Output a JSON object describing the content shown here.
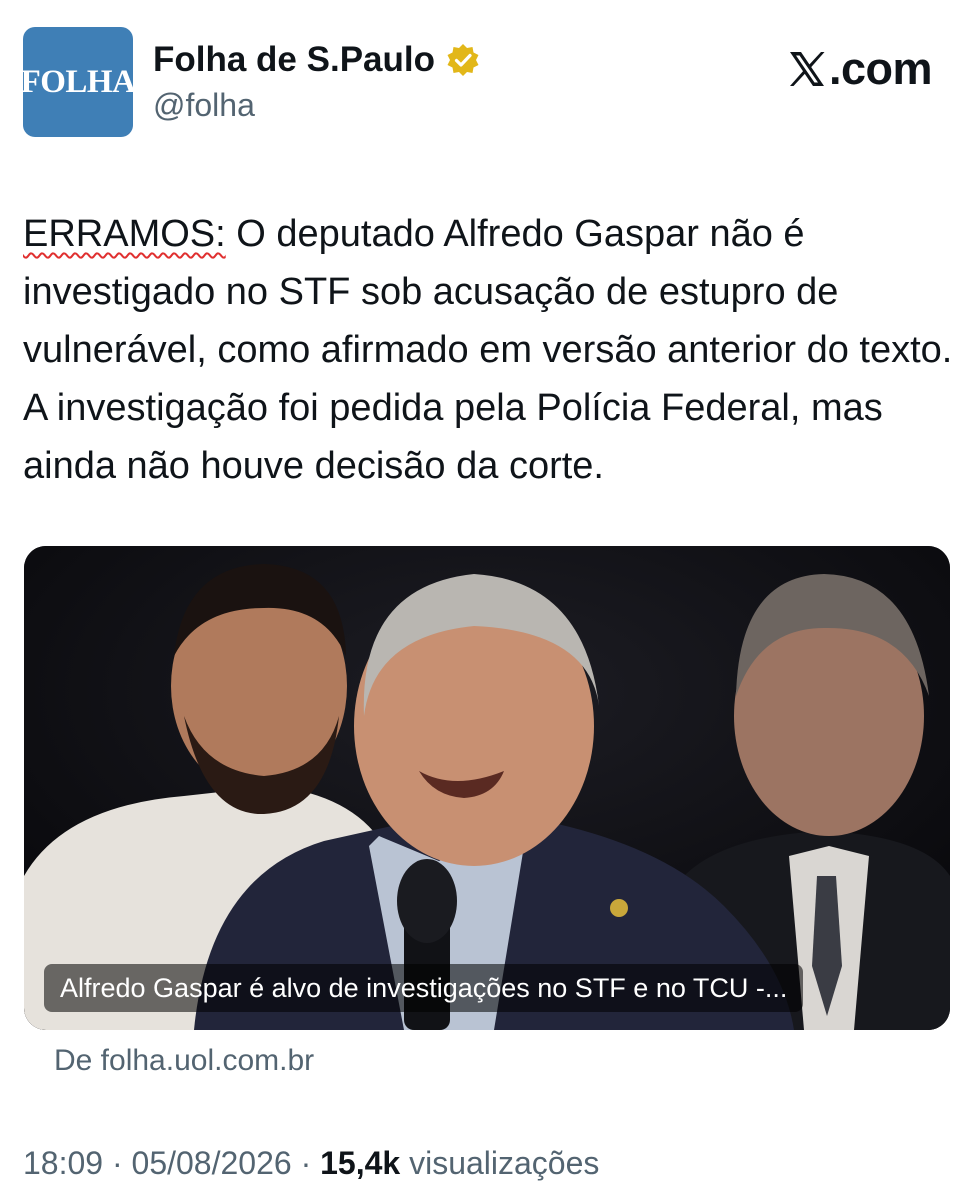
{
  "account": {
    "avatar_text": "FOLHA",
    "name": "Folha de S.Paulo",
    "handle": "@folha",
    "verified_icon": "gold-verified-badge-icon"
  },
  "brand": {
    "text": ".com",
    "logo_icon": "x-logo-icon"
  },
  "tweet": {
    "correction_label": "ERRAMOS:",
    "body": " O deputado Alfredo Gaspar não é investigado no STF sob acusação de estupro de vulnerável, como afirmado em versão anterior do texto. A investigação foi pedida pela Polícia Federal, mas ainda não houve decisão da corte."
  },
  "media": {
    "caption": "Alfredo Gaspar é alvo de investigações no STF e no TCU -...",
    "source": "De folha.uol.com.br"
  },
  "meta": {
    "time": "18:09",
    "separator": " · ",
    "date": "05/08/2026",
    "views_count": "15,4k",
    "views_label": "visualizações"
  },
  "colors": {
    "avatar_bg": "#3f7fb6",
    "verified_gold": "#e2b719",
    "secondary_text": "#536471",
    "correction_underline": "#e03030"
  }
}
